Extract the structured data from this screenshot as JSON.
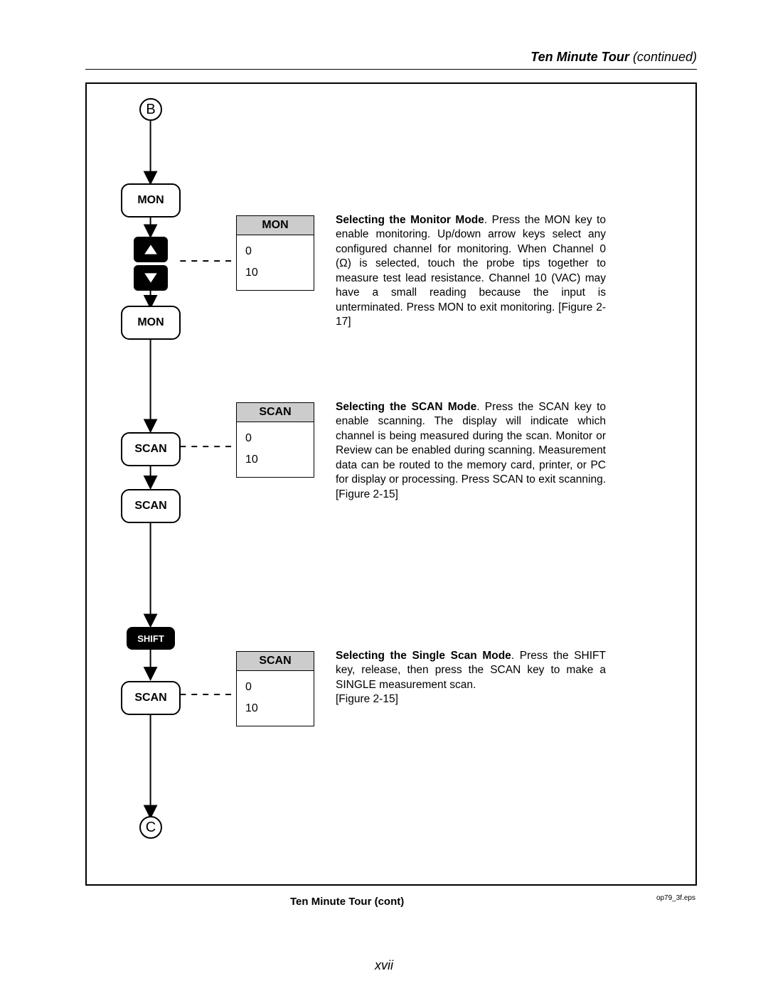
{
  "header": {
    "title": "Ten Minute Tour",
    "continued": " (continued)"
  },
  "connectors": {
    "top": "B",
    "bottom": "C"
  },
  "keys": {
    "mon1": "MON",
    "mon2": "MON",
    "scan1": "SCAN",
    "scan2": "SCAN",
    "scan3": "SCAN",
    "shift": "SHIFT"
  },
  "boxes": {
    "mon": {
      "title": "MON",
      "line1": "0",
      "line2": "10"
    },
    "scanA": {
      "title": "SCAN",
      "line1": "0",
      "line2": "10"
    },
    "scanB": {
      "title": "SCAN",
      "line1": "0",
      "line2": "10"
    }
  },
  "descriptions": {
    "mon": {
      "lead": "Selecting the Monitor Mode",
      "body": ".  Press the MON key to enable monitoring.  Up/down arrow keys select any configured channel for monitoring. When Channel 0 (Ω) is selected, touch the probe tips together to measure test lead resistance. Channel 10 (VAC) may have a small reading because the input is unterminated. Press MON to exit monitoring.  [Figure 2-17]"
    },
    "scan": {
      "lead": "Selecting the SCAN Mode",
      "body": ".  Press the SCAN key to enable scanning.  The display will indicate which channel is being measured during the scan.  Monitor or Review can be enabled during scanning.  Measurement data can be routed to the memory card, printer, or PC for display or processing.  Press SCAN to exit scanning. [Figure 2-15]"
    },
    "single": {
      "lead": "Selecting the Single Scan Mode",
      "body": ".  Press the SHIFT key, release, then press the SCAN key to make a SINGLE measurement scan.",
      "fig": "[Figure 2-15]"
    }
  },
  "caption": "Ten Minute Tour (cont)",
  "epsLabel": "op79_3f.eps",
  "pageNum": "xvii"
}
